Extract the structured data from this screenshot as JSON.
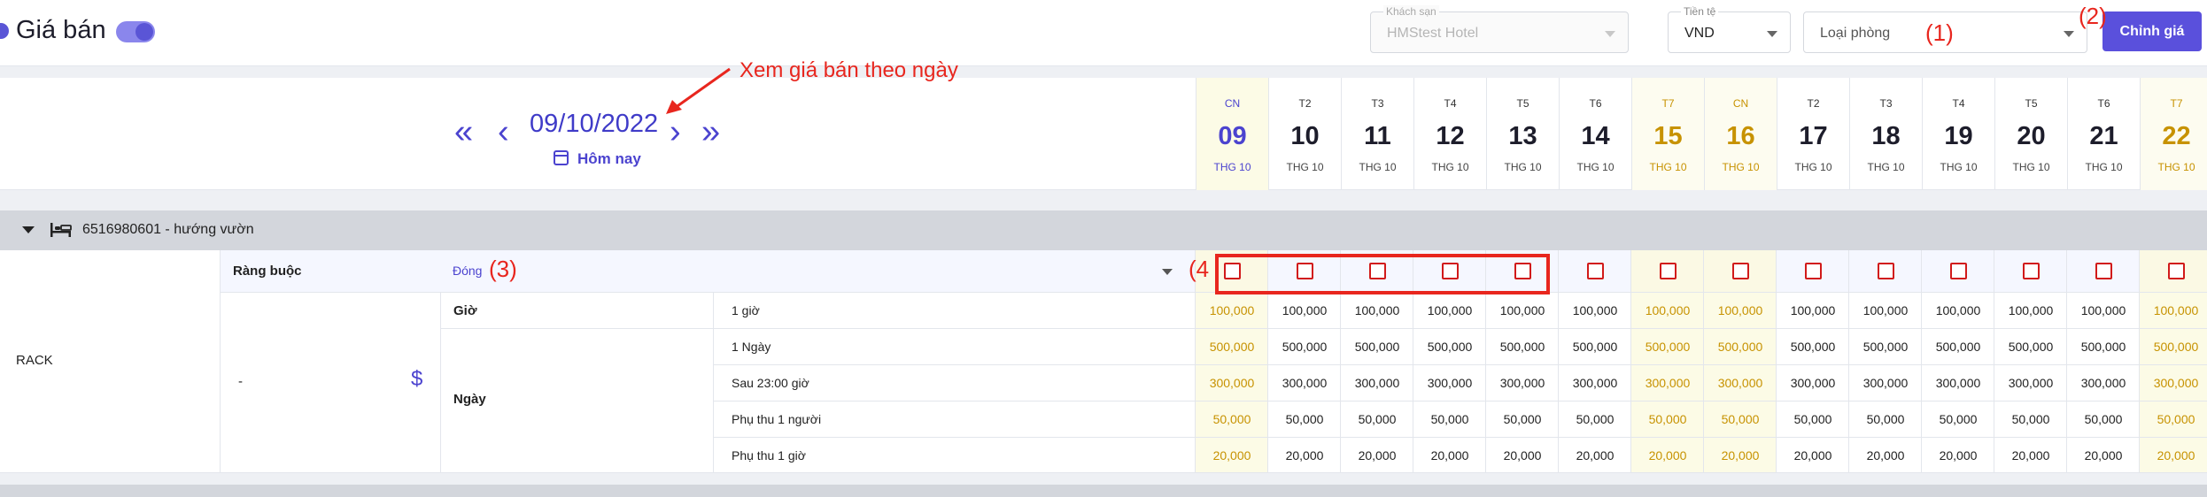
{
  "header": {
    "title": "Giá bán",
    "hotel_field": {
      "label": "Khách sạn",
      "value": "HMStest Hotel"
    },
    "currency_field": {
      "label": "Tiền tệ",
      "value": "VND"
    },
    "room_type_field": {
      "placeholder": "Loại phòng"
    },
    "edit_button": "Chỉnh giá"
  },
  "annotations": {
    "room_type": "(1)",
    "edit": "(2)",
    "restriction": "(3)",
    "checkboxes": "(4",
    "date_note": "Xem giá bán theo ngày"
  },
  "datebar": {
    "current_date": "09/10/2022",
    "today_label": "Hôm nay",
    "first_icon": "double-chevron-left-icon",
    "prev_icon": "chevron-left-icon",
    "next_icon": "chevron-right-icon",
    "last_icon": "double-chevron-right-icon",
    "days": [
      {
        "dow": "CN",
        "day": "09",
        "month": "THG 10",
        "type": "today"
      },
      {
        "dow": "T2",
        "day": "10",
        "month": "THG 10",
        "type": "weekday"
      },
      {
        "dow": "T3",
        "day": "11",
        "month": "THG 10",
        "type": "weekday"
      },
      {
        "dow": "T4",
        "day": "12",
        "month": "THG 10",
        "type": "weekday"
      },
      {
        "dow": "T5",
        "day": "13",
        "month": "THG 10",
        "type": "weekday"
      },
      {
        "dow": "T6",
        "day": "14",
        "month": "THG 10",
        "type": "weekday"
      },
      {
        "dow": "T7",
        "day": "15",
        "month": "THG 10",
        "type": "weekend"
      },
      {
        "dow": "CN",
        "day": "16",
        "month": "THG 10",
        "type": "weekend"
      },
      {
        "dow": "T2",
        "day": "17",
        "month": "THG 10",
        "type": "weekday"
      },
      {
        "dow": "T3",
        "day": "18",
        "month": "THG 10",
        "type": "weekday"
      },
      {
        "dow": "T4",
        "day": "19",
        "month": "THG 10",
        "type": "weekday"
      },
      {
        "dow": "T5",
        "day": "20",
        "month": "THG 10",
        "type": "weekday"
      },
      {
        "dow": "T6",
        "day": "21",
        "month": "THG 10",
        "type": "weekday"
      },
      {
        "dow": "T7",
        "day": "22",
        "month": "THG 10",
        "type": "weekend"
      }
    ]
  },
  "room_group": {
    "name": "6516980601 - hướng vườn",
    "icon": "bed-icon"
  },
  "table": {
    "rate_plan": "RACK",
    "restriction_label": "Ràng buộc",
    "restriction_value": "Đóng",
    "dash": "-",
    "currency_icon": "dollar-icon",
    "groups": {
      "hour": "Giờ",
      "day": "Ngày"
    },
    "rows": [
      {
        "label": "1 giờ",
        "values": [
          "100,000",
          "100,000",
          "100,000",
          "100,000",
          "100,000",
          "100,000",
          "100,000",
          "100,000",
          "100,000",
          "100,000",
          "100,000",
          "100,000",
          "100,000",
          "100,000"
        ]
      },
      {
        "label": "1 Ngày",
        "values": [
          "500,000",
          "500,000",
          "500,000",
          "500,000",
          "500,000",
          "500,000",
          "500,000",
          "500,000",
          "500,000",
          "500,000",
          "500,000",
          "500,000",
          "500,000",
          "500,000"
        ]
      },
      {
        "label": "Sau 23:00 giờ",
        "values": [
          "300,000",
          "300,000",
          "300,000",
          "300,000",
          "300,000",
          "300,000",
          "300,000",
          "300,000",
          "300,000",
          "300,000",
          "300,000",
          "300,000",
          "300,000",
          "300,000"
        ]
      },
      {
        "label": "Phụ thu 1 người",
        "values": [
          "50,000",
          "50,000",
          "50,000",
          "50,000",
          "50,000",
          "50,000",
          "50,000",
          "50,000",
          "50,000",
          "50,000",
          "50,000",
          "50,000",
          "50,000",
          "50,000"
        ]
      },
      {
        "label": "Phụ thu 1 giờ",
        "values": [
          "20,000",
          "20,000",
          "20,000",
          "20,000",
          "20,000",
          "20,000",
          "20,000",
          "20,000",
          "20,000",
          "20,000",
          "20,000",
          "20,000",
          "20,000",
          "20,000"
        ]
      }
    ]
  },
  "colors": {
    "accent": "#4b43cf",
    "today_bg": "#fcfbe6",
    "weekend_text": "#c79200",
    "annotation": "#e8261e"
  }
}
